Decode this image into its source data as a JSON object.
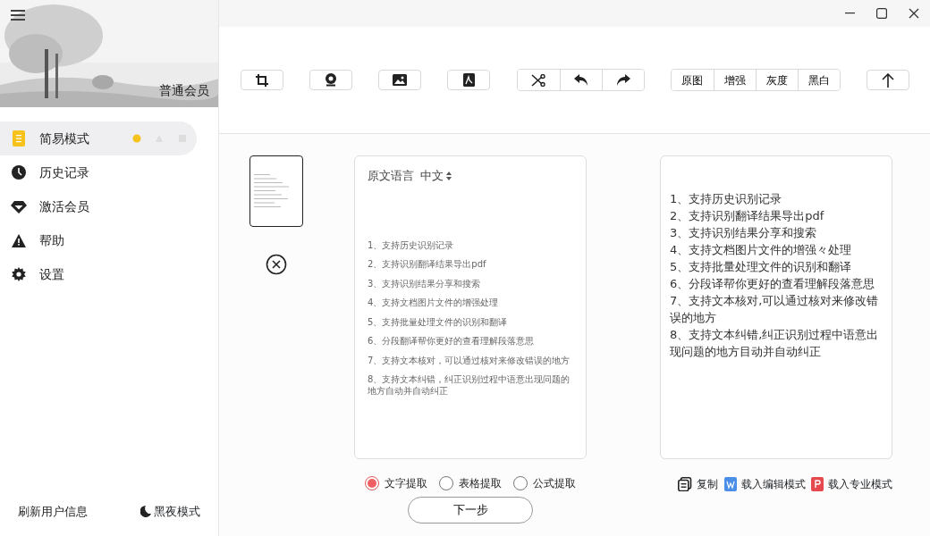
{
  "sidebar": {
    "member_label": "普通会员",
    "items": [
      {
        "label": "简易模式",
        "selected": true
      },
      {
        "label": "历史记录",
        "selected": false
      },
      {
        "label": "激活会员",
        "selected": false
      },
      {
        "label": "帮助",
        "selected": false
      },
      {
        "label": "设置",
        "selected": false
      }
    ],
    "refresh_label": "刷新用户信息",
    "night_mode_label": "黑夜模式"
  },
  "toolbar": {
    "filters": [
      {
        "label": "原图",
        "selected": false
      },
      {
        "label": "增强",
        "selected": false
      },
      {
        "label": "灰度",
        "selected": false
      },
      {
        "label": "黑白",
        "selected": false
      }
    ]
  },
  "thumbnails": [
    {
      "selected": true
    }
  ],
  "source": {
    "language_label": "原文语言",
    "language": "中文",
    "lines": [
      "1、支持历史识别记录",
      "2、支持识别翻译结果导出pdf",
      "3、支持识别结果分享和搜索",
      "4、支持文档图片文件的增强处理",
      "5、支持批量处理文件的识别和翻译",
      "6、分段翻译帮你更好的查看理解段落意思",
      "7、支持文本核对，可以通过核对来修改错误的地方",
      "8、支持文本纠错，纠正识别过程中语意出现问题的地方自动并自动纠正"
    ]
  },
  "result": {
    "lines": [
      "1、支持历史识别记录",
      "2、支持识别翻译结果导出pdf",
      "3、支持识别结果分享和搜索",
      "4、支持文档图片文件的增强々处理",
      "5、支持批量处理文件的识别和翻译",
      "6、分段译帮你更好的查看理解段落意思",
      "7、支持文本核对,可以通过核对来修改错误的地方",
      "8、支持文本纠错,纠正识别过程中语意出现问题的地方目动并自动纠正"
    ]
  },
  "extract_modes": [
    {
      "label": "文字提取",
      "selected": true
    },
    {
      "label": "表格提取",
      "selected": false
    },
    {
      "label": "公式提取",
      "selected": false
    }
  ],
  "actions": [
    {
      "label": "复制",
      "kind": "copy"
    },
    {
      "label": "载入编辑模式",
      "kind": "word"
    },
    {
      "label": "载入专业模式",
      "kind": "ppt"
    }
  ],
  "next_button": "下一步"
}
